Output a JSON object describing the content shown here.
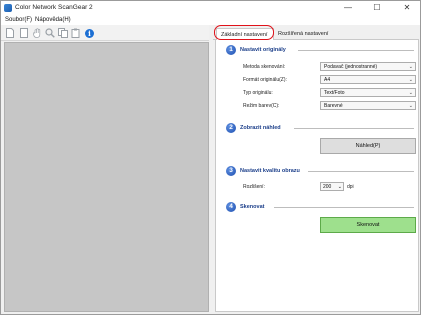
{
  "window": {
    "title": "Color Network ScanGear 2",
    "controls": {
      "minimize": "—",
      "maximize": "☐",
      "close": "✕"
    }
  },
  "menu": {
    "file": "Soubor(F)",
    "help": "Nápověda(H)"
  },
  "toolbar": {
    "icons": [
      "new-page-icon",
      "blank-page-icon",
      "hand-icon",
      "zoom-icon",
      "copy-icon",
      "paste-icon",
      "info-icon"
    ],
    "info_glyph": "i"
  },
  "tabs": {
    "basic": "Základní nastavení",
    "advanced": "Rozšířená nastavení"
  },
  "section1": {
    "number": "1",
    "title": "Nastavit originály",
    "rows": [
      {
        "label": "Metoda skenování:",
        "value": "Podavač (jednostranné)"
      },
      {
        "label": "Formát originálu(Z):",
        "value": "A4"
      },
      {
        "label": "Typ originálu:",
        "value": "Text/Foto"
      },
      {
        "label": "Režim barev(C):",
        "value": "Barevné"
      }
    ]
  },
  "section2": {
    "number": "2",
    "title": "Zobrazit náhled",
    "button": "Náhled(P)"
  },
  "section3": {
    "number": "3",
    "title": "Nastavit kvalitu obrazu",
    "resolution_label": "Rozlišení:",
    "resolution_value": "200",
    "resolution_unit": "dpi"
  },
  "section4": {
    "number": "4",
    "title": "Skenovat",
    "button": "Skenovat"
  }
}
